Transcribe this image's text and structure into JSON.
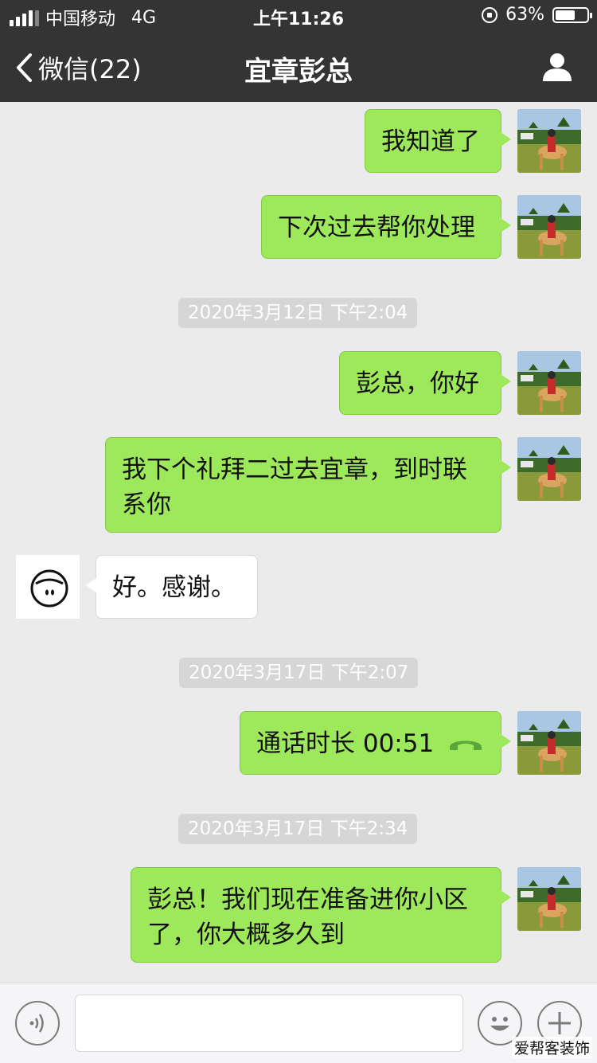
{
  "status_bar": {
    "carrier": "中国移动",
    "network": "4G",
    "time": "上午11:26",
    "battery_percent": "63%",
    "battery_level": 0.63
  },
  "nav": {
    "back_label": "微信(22)",
    "title": "宜章彭总"
  },
  "messages": [
    {
      "sender": "me",
      "text": "我知道了"
    },
    {
      "sender": "me",
      "text": "下次过去帮你处理"
    },
    {
      "timestamp": "2020年3月12日 下午2:04"
    },
    {
      "sender": "me",
      "text": "彭总，你好"
    },
    {
      "sender": "me",
      "text": "我下个礼拜二过去宜章，到时联系你"
    },
    {
      "sender": "other",
      "text": "好。感谢。"
    },
    {
      "timestamp": "2020年3月17日 下午2:07"
    },
    {
      "sender": "me",
      "type": "call",
      "text": "通话时长 00:51"
    },
    {
      "timestamp": "2020年3月17日 下午2:34"
    },
    {
      "sender": "me",
      "text": "彭总！我们现在准备进你小区了，你大概多久到"
    }
  ],
  "input_bar": {
    "voice_icon": "voice-icon",
    "emoji_icon": "emoji-icon",
    "plus_icon": "plus-icon"
  },
  "watermark": "爱帮客装饰",
  "colors": {
    "header_bg": "#343434",
    "chat_bg": "#ebebeb",
    "my_bubble": "#9ee85b",
    "their_bubble": "#ffffff",
    "call_icon": "#5aa63b"
  }
}
